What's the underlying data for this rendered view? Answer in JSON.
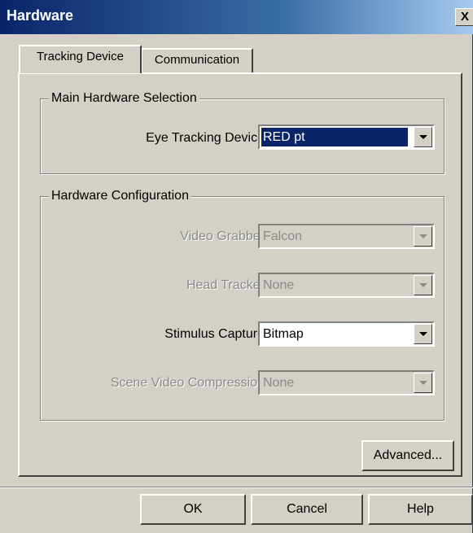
{
  "window": {
    "title": "Hardware",
    "close_label": "X"
  },
  "tabs": [
    {
      "label": "Tracking Device",
      "active": true
    },
    {
      "label": "Communication",
      "active": false
    }
  ],
  "main_selection": {
    "group_label": "Main Hardware Selection",
    "eye_tracking_device": {
      "label": "Eye Tracking Device",
      "value": "RED pt",
      "enabled": true,
      "focused": true
    }
  },
  "configuration": {
    "group_label": "Hardware Configuration",
    "video_grabber": {
      "label": "Video Grabber",
      "value": "Falcon",
      "enabled": false
    },
    "head_tracker": {
      "label": "Head Tracker",
      "value": "None",
      "enabled": false
    },
    "stimulus_capture": {
      "label": "Stimulus Capture",
      "value": "Bitmap",
      "enabled": true
    },
    "scene_video_compression": {
      "label": "Scene Video Compression",
      "value": "None",
      "enabled": false
    }
  },
  "buttons": {
    "advanced": "Advanced...",
    "ok": "OK",
    "cancel": "Cancel",
    "help": "Help"
  },
  "colors": {
    "titlebar": "#0a246a",
    "dialog_face": "#d4d0c8",
    "selection": "#0a246a"
  }
}
